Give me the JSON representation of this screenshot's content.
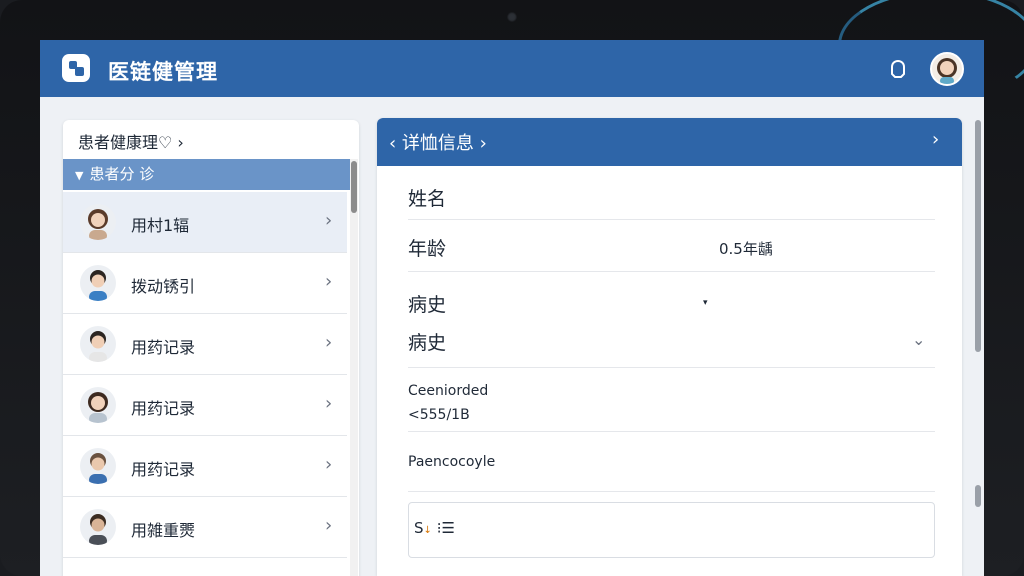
{
  "app": {
    "title": "医链健管理"
  },
  "left_panel": {
    "header": "患者健康理♡ ›",
    "group_label": "患者分 诊",
    "items": [
      {
        "label": "用村1辐",
        "avatar": "female-avatar",
        "active": true
      },
      {
        "label": "拨动锈引",
        "avatar": "male-avatar",
        "active": false
      },
      {
        "label": "用药记录",
        "avatar": "male-avatar",
        "active": false
      },
      {
        "label": "用药记录",
        "avatar": "female-avatar",
        "active": false
      },
      {
        "label": "用药记录",
        "avatar": "male-avatar",
        "active": false
      },
      {
        "label": "用雑重燛",
        "avatar": "male-avatar",
        "active": false
      }
    ]
  },
  "detail": {
    "title": "‹ 详恤信息 ›",
    "next_chevron": "›",
    "name_label": "姓名",
    "age_label": "年龄",
    "age_value": "0.5年龋",
    "history_label_1": "病史",
    "history_label_2": "病史",
    "record_label": "Ceeniorded",
    "record_value": "<555/1B",
    "note_label": "Paencocoyle",
    "box_label": "S",
    "box_icon_text": "⁝☰"
  },
  "icons": {
    "chevron_right": "›",
    "chevron_down": "⌄",
    "dropdown": "▾"
  },
  "colors": {
    "brand": "#2e65a8",
    "group_header": "#6a94c8"
  }
}
